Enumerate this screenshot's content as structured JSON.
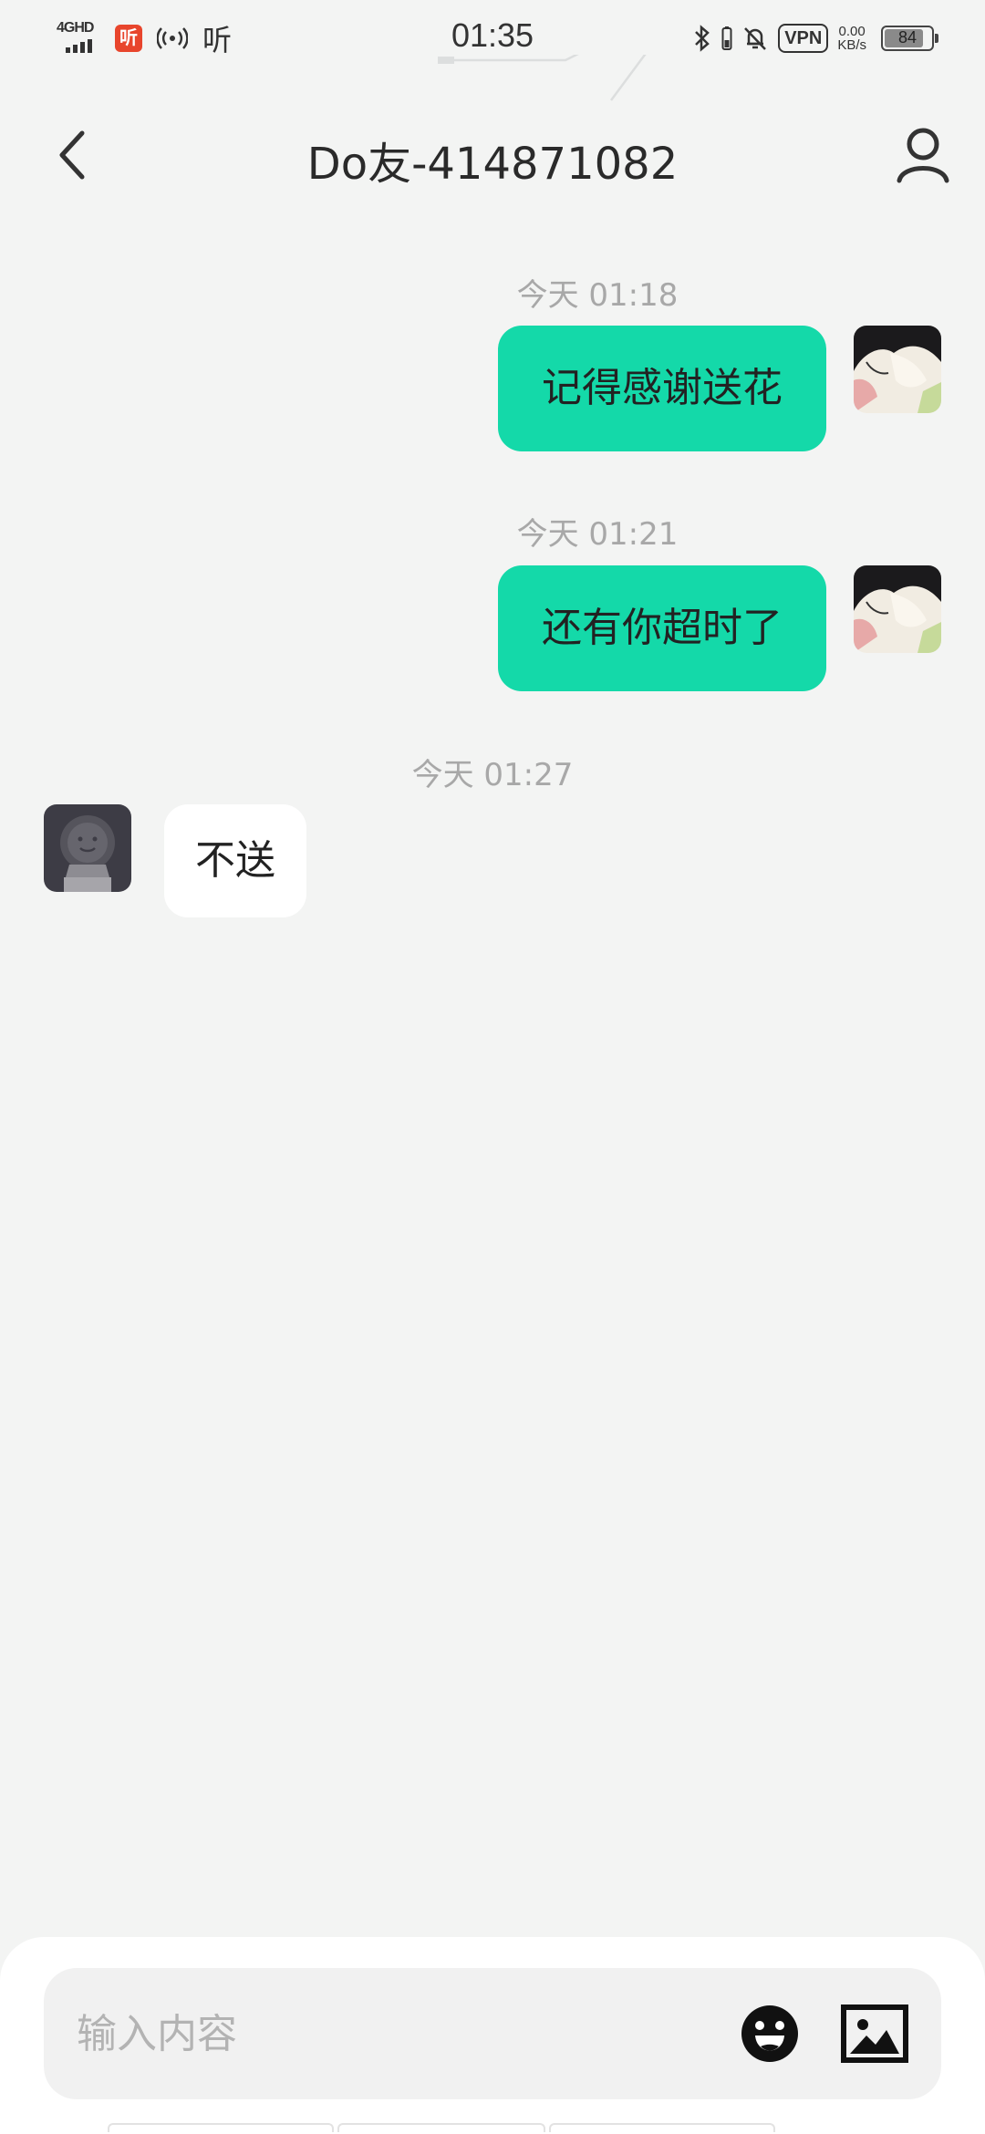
{
  "status_bar": {
    "network": "4GHD",
    "app_badge_char": "听",
    "listen_label": "听",
    "time": "01:35",
    "vpn_label": "VPN",
    "speed_value": "0.00",
    "speed_unit": "KB/s",
    "battery_level": "84"
  },
  "header": {
    "title": "Do友-414871082",
    "back_icon": "chevron-left-icon",
    "profile_icon": "person-icon"
  },
  "messages": [
    {
      "timestamp": "今天 01:18",
      "text": "记得感谢送花",
      "direction": "outgoing"
    },
    {
      "timestamp": "今天 01:21",
      "text": "还有你超时了",
      "direction": "outgoing"
    },
    {
      "timestamp": "今天 01:27",
      "text": "不送",
      "direction": "incoming"
    }
  ],
  "input": {
    "placeholder": "输入内容",
    "emoji_icon": "emoji-icon",
    "image_icon": "image-icon"
  },
  "colors": {
    "accent": "#14d9a9",
    "background": "#f3f4f3",
    "timestamp": "#a8a8a8"
  }
}
